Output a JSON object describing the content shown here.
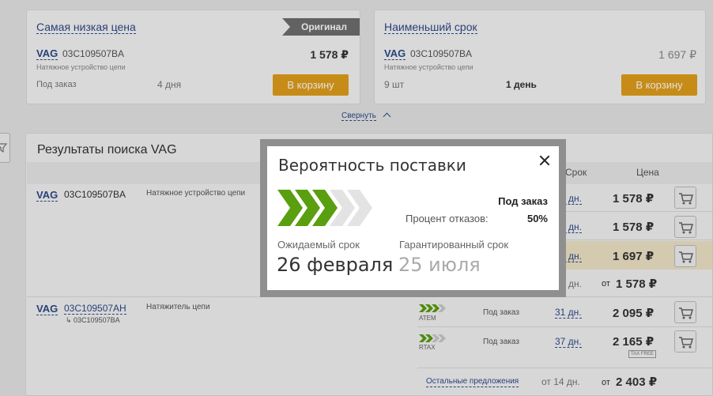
{
  "cards": [
    {
      "title": "Самая низкая цена",
      "ribbon": "Оригинал",
      "brand": "VAG",
      "part": "03C109507BA",
      "desc": "Натяжное устройство цепи",
      "price": "1 578 ₽",
      "status": "Под заказ",
      "days": "4 дня",
      "button": "В корзину"
    },
    {
      "title": "Наименьший срок",
      "brand": "VAG",
      "part": "03C109507BA",
      "desc": "Натяжное устройство цепи",
      "price": "1 697 ₽",
      "qty": "9 шт",
      "days": "1 день",
      "button": "В корзину"
    }
  ],
  "collapse": "Свернуть",
  "results": {
    "title": "Результаты поиска VAG",
    "headers": {
      "term": "Срок",
      "price": "Цена"
    },
    "group1": {
      "brand": "VAG",
      "part": "03C109507BA",
      "desc": "Натяжное устройство цепи",
      "rows": [
        {
          "term": "4 дн.",
          "price": "1 578 ₽"
        },
        {
          "term": "9 дн.",
          "price": "1 578 ₽"
        },
        {
          "term": "1 дн.",
          "price": "1 697 ₽"
        }
      ],
      "summary_term": "4 дн.",
      "summary_from": "от",
      "summary_price": "1 578 ₽"
    },
    "group2": {
      "brand": "VAG",
      "part": "03C109507AH",
      "alt_part": "↳ 03C109507BA",
      "desc": "Натяжитель цепи",
      "rows": [
        {
          "provider": "ATEM",
          "status": "Под заказ",
          "term": "31 дн.",
          "price": "2 095 ₽"
        },
        {
          "provider": "RTAX",
          "status": "Под заказ",
          "term": "37 дн.",
          "price": "2 165 ₽",
          "badge": "TAX FREE"
        }
      ],
      "other_offers": "Остальные предложения",
      "other_term": "от 14 дн.",
      "other_from": "от",
      "other_price": "2 403 ₽"
    }
  },
  "modal": {
    "title": "Вероятность поставки",
    "probability_level": 0.6,
    "status": "Под заказ",
    "refusal_label": "Процент отказов:",
    "refusal_value": "50%",
    "expected_label": "Ожидаемый срок",
    "expected_date": "26 февраля",
    "guaranteed_label": "Гарантированный срок",
    "guaranteed_date": "25 июля"
  },
  "colors": {
    "accent_green": "#5a9f0f",
    "link_blue": "#2f4a8a",
    "cart_orange": "#e3a01c"
  },
  "icons": [
    "filter-icon",
    "cart-icon",
    "close-icon",
    "chevron-up-icon",
    "delivery-chevrons-icon"
  ]
}
